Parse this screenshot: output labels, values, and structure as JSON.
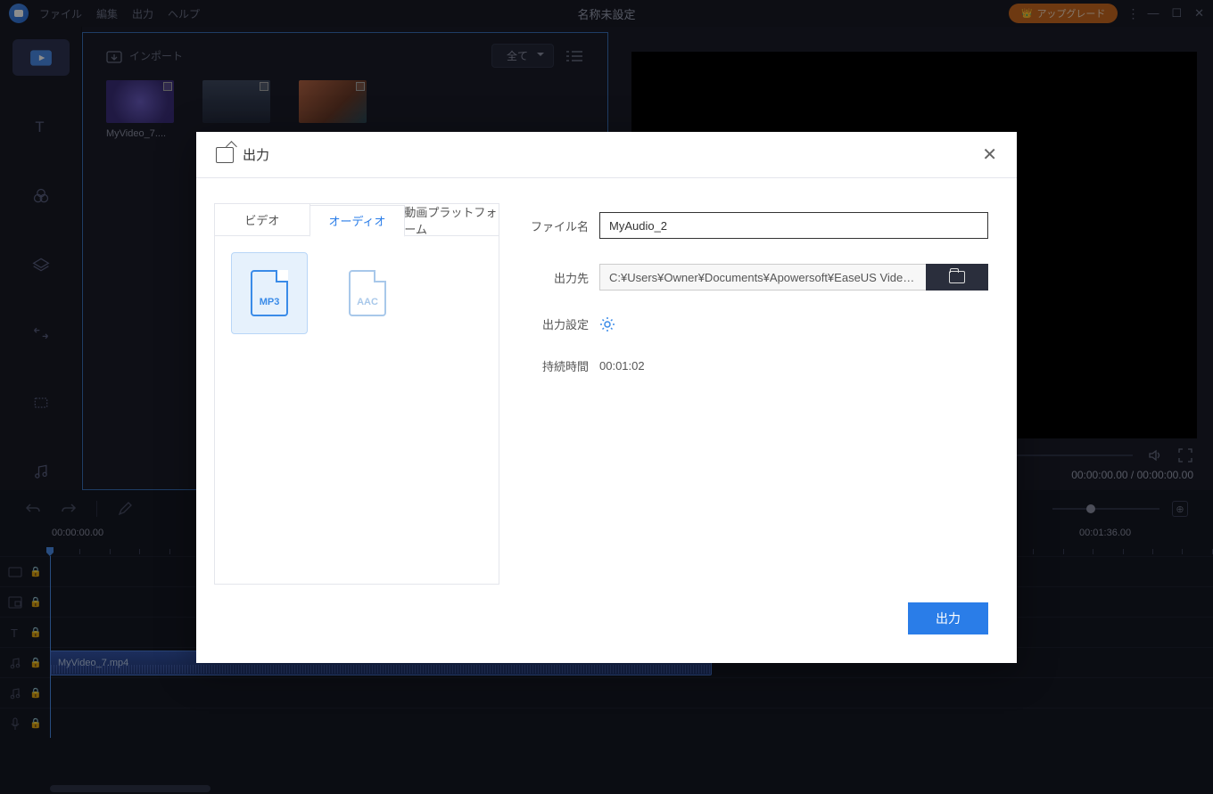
{
  "titlebar": {
    "menu": [
      "ファイル",
      "編集",
      "出力",
      "ヘルプ"
    ],
    "title": "名称未設定",
    "upgrade": "アップグレード"
  },
  "media_panel": {
    "import": "インポート",
    "filter": "全て",
    "thumbs": [
      "MyVideo_7....",
      "",
      ""
    ]
  },
  "preview": {
    "time": "00:00:00.00 / 00:00:00.00"
  },
  "timeline": {
    "start_time": "00:00:00.00",
    "end_mark": "00:01:36.00",
    "clip": "MyVideo_7.mp4"
  },
  "modal": {
    "title": "出力",
    "tabs": [
      "ビデオ",
      "オーディオ",
      "動画プラットフォーム"
    ],
    "formats": [
      "MP3",
      "AAC"
    ],
    "labels": {
      "filename": "ファイル名",
      "output_path": "出力先",
      "output_settings": "出力設定",
      "duration": "持続時間"
    },
    "filename_value": "MyAudio_2",
    "output_path_value": "C:¥Users¥Owner¥Documents¥Apowersoft¥EaseUS Video E",
    "duration_value": "00:01:02",
    "export_btn": "出力"
  }
}
